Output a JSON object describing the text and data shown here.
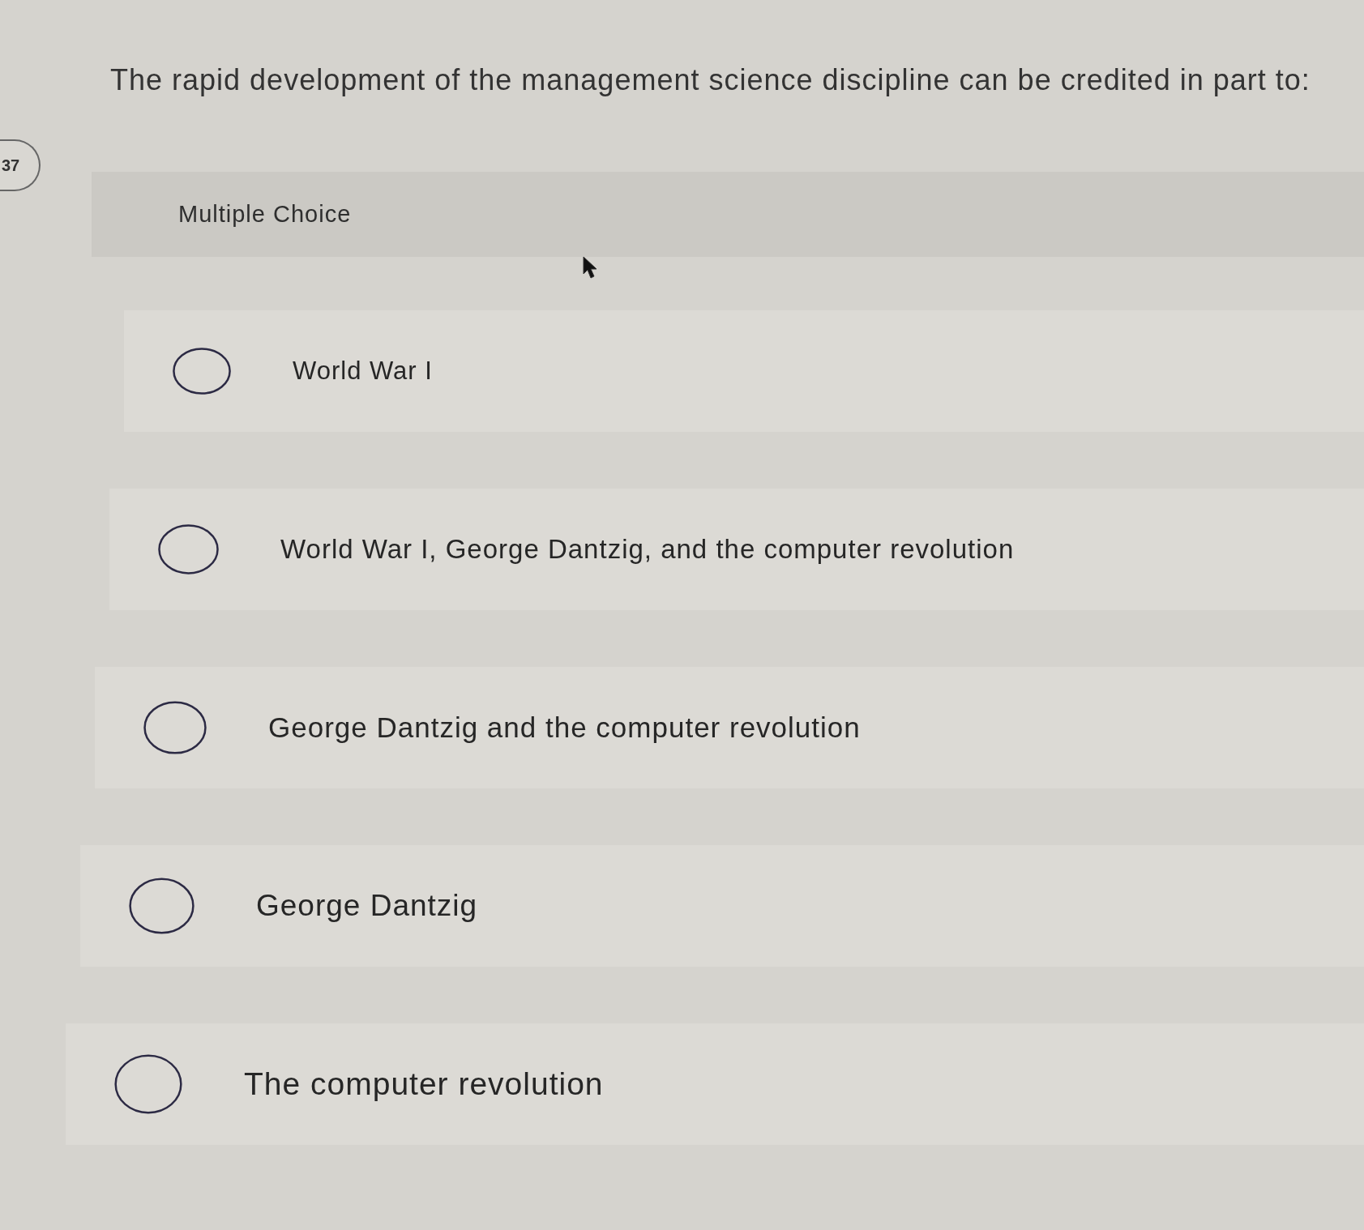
{
  "question_badge": "37",
  "question": "The rapid development of the management science discipline can be credited in part to:",
  "answer_type": "Multiple Choice",
  "options": [
    {
      "label": "World War I",
      "selected": false
    },
    {
      "label": "World War I, George Dantzig, and the computer revolution",
      "selected": false
    },
    {
      "label": "George Dantzig and the computer revolution",
      "selected": false
    },
    {
      "label": "George Dantzig",
      "selected": false
    },
    {
      "label": "The computer revolution",
      "selected": false
    }
  ]
}
